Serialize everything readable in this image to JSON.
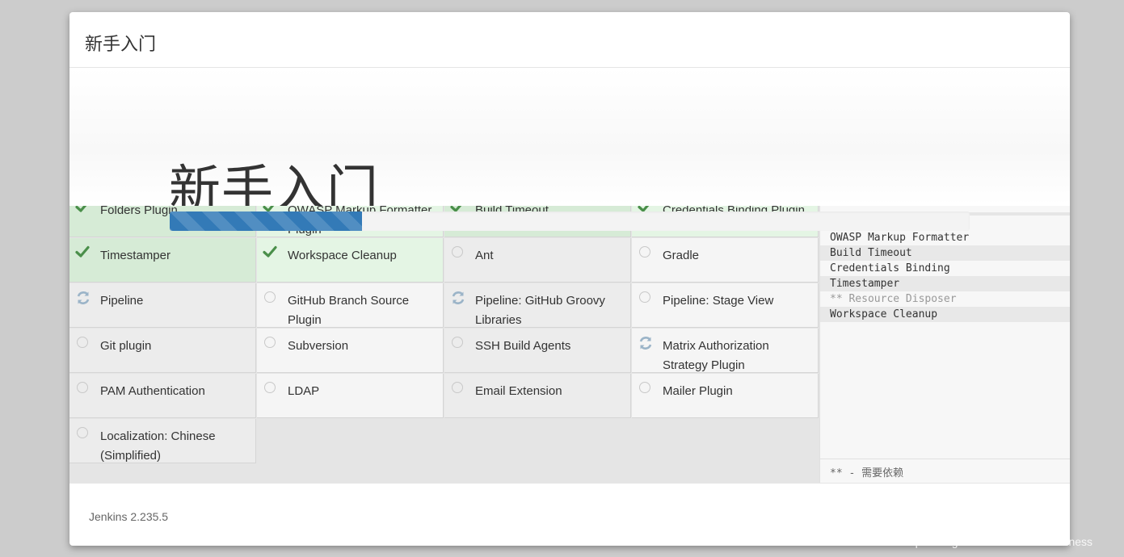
{
  "dialog": {
    "title": "新手入门",
    "hero_title": "新手入门"
  },
  "progress": {
    "percent": 24
  },
  "plugins": [
    {
      "label": "Folders Plugin",
      "status": "installed"
    },
    {
      "label": "OWASP Markup Formatter Plugin",
      "status": "installed"
    },
    {
      "label": "Build Timeout",
      "status": "installed"
    },
    {
      "label": "Credentials Binding Plugin",
      "status": "installed"
    },
    {
      "label": "Timestamper",
      "status": "installed"
    },
    {
      "label": "Workspace Cleanup",
      "status": "installed"
    },
    {
      "label": "Ant",
      "status": "pending"
    },
    {
      "label": "Gradle",
      "status": "pending"
    },
    {
      "label": "Pipeline",
      "status": "installing"
    },
    {
      "label": "GitHub Branch Source Plugin",
      "status": "pending"
    },
    {
      "label": "Pipeline: GitHub Groovy Libraries",
      "status": "installing"
    },
    {
      "label": "Pipeline: Stage View",
      "status": "pending"
    },
    {
      "label": "Git plugin",
      "status": "pending"
    },
    {
      "label": "Subversion",
      "status": "pending"
    },
    {
      "label": "SSH Build Agents",
      "status": "pending"
    },
    {
      "label": "Matrix Authorization Strategy Plugin",
      "status": "installing"
    },
    {
      "label": "PAM Authentication",
      "status": "pending"
    },
    {
      "label": "LDAP",
      "status": "pending"
    },
    {
      "label": "Email Extension",
      "status": "pending"
    },
    {
      "label": "Mailer Plugin",
      "status": "pending"
    },
    {
      "label": "Localization: Chinese (Simplified)",
      "status": "pending"
    }
  ],
  "log": {
    "items": [
      {
        "text": "OWASP Markup Formatter",
        "dependency": false
      },
      {
        "text": "Build Timeout",
        "dependency": false
      },
      {
        "text": "Credentials Binding",
        "dependency": false
      },
      {
        "text": "Timestamper",
        "dependency": false
      },
      {
        "text": "** Resource Disposer",
        "dependency": true
      },
      {
        "text": "Workspace Cleanup",
        "dependency": false
      }
    ],
    "footnote": "** - 需要依赖"
  },
  "footer": {
    "version": "Jenkins 2.235.5"
  },
  "watermark": "https://blog.csdn.net/finalAmativeness",
  "colors": {
    "progress": "#337ab7",
    "check": "#4a8f4a",
    "spinner": "#9bb4c8"
  }
}
